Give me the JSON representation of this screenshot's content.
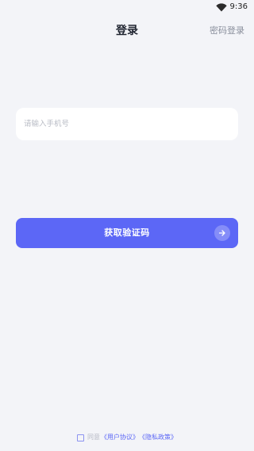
{
  "status_bar": {
    "time": "9:36",
    "wifi_icon": "wifi-icon"
  },
  "header": {
    "title": "登录",
    "password_login": "密码登录"
  },
  "phone_input": {
    "placeholder": "请输入手机号",
    "value": ""
  },
  "get_code_button": {
    "label": "获取验证码",
    "icon": "arrow-right-icon"
  },
  "agreement": {
    "checked": false,
    "prefix": "同意",
    "user_agreement": "《用户协议》",
    "privacy_policy": "《隐私政策》"
  },
  "colors": {
    "background": "#f3f4f8",
    "accent": "#5c67f6",
    "title_text": "#1f2430",
    "secondary_text": "#8a8f9c",
    "placeholder_text": "#b9bcc5"
  }
}
